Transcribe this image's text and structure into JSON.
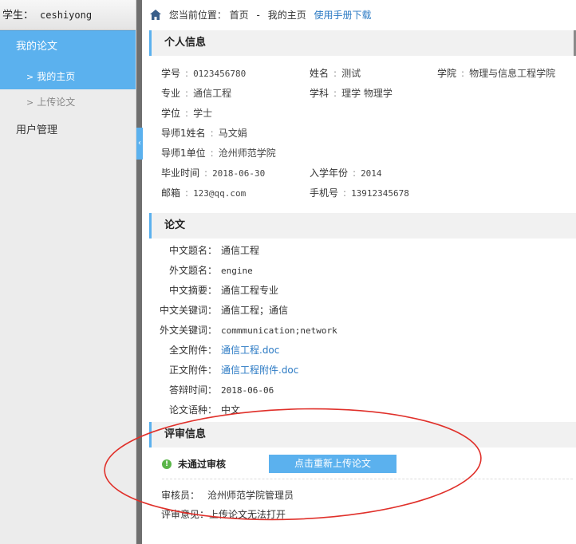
{
  "sidebar": {
    "student_label": "学生：",
    "student_name": "ceshiyong",
    "nav": {
      "my_thesis": "我的论文",
      "my_home": "我的主页",
      "upload_thesis": "上传论文",
      "user_mgmt": "用户管理"
    },
    "sub_arrow": ">",
    "collapse_glyph": "‹"
  },
  "breadcrumb": {
    "label": "您当前位置：",
    "home": "首页",
    "sep": "-",
    "current": "我的主页",
    "manual_link": "使用手册下载"
  },
  "personal": {
    "title": "个人信息",
    "colon": ":",
    "student_no": {
      "label": "学号",
      "value": "0123456780"
    },
    "name": {
      "label": "姓名",
      "value": "测试"
    },
    "college": {
      "label": "学院",
      "value": "物理与信息工程学院"
    },
    "major": {
      "label": "专业",
      "value": "通信工程"
    },
    "subject": {
      "label": "学科",
      "value": "理学 物理学"
    },
    "degree": {
      "label": "学位",
      "value": "学士"
    },
    "advisor_name": {
      "label": "导师1姓名",
      "value": "马文娟"
    },
    "advisor_unit": {
      "label": "导师1单位",
      "value": "沧州师范学院"
    },
    "grad_time": {
      "label": "毕业时间",
      "value": "2018-06-30"
    },
    "enroll_year": {
      "label": "入学年份",
      "value": "2014"
    },
    "email": {
      "label": "邮箱",
      "value": "123@qq.com"
    },
    "phone": {
      "label": "手机号",
      "value": "13912345678"
    }
  },
  "paper": {
    "title": "论文",
    "rows": [
      {
        "label": "中文题名：",
        "value": "通信工程",
        "link": false
      },
      {
        "label": "外文题名：",
        "value": "engine",
        "link": false
      },
      {
        "label": "中文摘要：",
        "value": "通信工程专业",
        "link": false
      },
      {
        "label": "中文关键词：",
        "value": "通信工程；通信",
        "link": false
      },
      {
        "label": "外文关键词：",
        "value": "commmunication;network",
        "link": false
      },
      {
        "label": "全文附件：",
        "value": "通信工程.doc",
        "link": true
      },
      {
        "label": "正文附件：",
        "value": "通信工程附件.doc",
        "link": true
      },
      {
        "label": "答辩时间：",
        "value": "2018-06-06",
        "link": false
      },
      {
        "label": "论文语种：",
        "value": "中文",
        "link": false
      }
    ]
  },
  "review": {
    "title": "评审信息",
    "status_icon": "!",
    "status": "未通过审核",
    "reupload_button": "点击重新上传论文",
    "reviewer_label": "审核员：",
    "reviewer": "沧州师范学院管理员",
    "comment_label": "评审意见：",
    "comment": "上传论文无法打开"
  },
  "colors": {
    "accent": "#5bb1ee",
    "link": "#2b7ac4",
    "status_ok_icon": "#59b548",
    "annotation": "#e0302a"
  }
}
